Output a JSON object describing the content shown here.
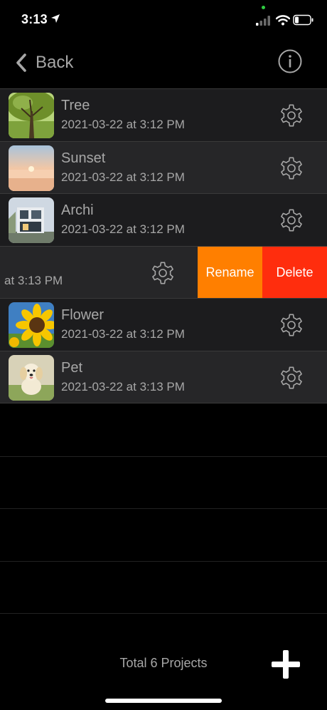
{
  "status": {
    "time": "3:13"
  },
  "nav": {
    "back_label": "Back"
  },
  "projects": [
    {
      "title": "Tree",
      "date": "2021-03-22 at 3:12 PM"
    },
    {
      "title": "Sunset",
      "date": "2021-03-22 at 3:12 PM"
    },
    {
      "title": "Archi",
      "date": "2021-03-22 at 3:12 PM"
    },
    {
      "title": "",
      "date": "at 3:13 PM"
    },
    {
      "title": "Flower",
      "date": "2021-03-22 at 3:12 PM"
    },
    {
      "title": "Pet",
      "date": "2021-03-22 at 3:13 PM"
    }
  ],
  "swipe_actions": {
    "rename": "Rename",
    "delete": "Delete"
  },
  "footer": {
    "total": "Total 6 Projects"
  },
  "colors": {
    "rename": "#ff7f00",
    "delete": "#ff2d0d",
    "text": "#a7a7a7"
  },
  "icons": {
    "back": "chevron-left-icon",
    "info": "info-circle-icon",
    "gear": "gear-icon",
    "add": "plus-icon"
  }
}
